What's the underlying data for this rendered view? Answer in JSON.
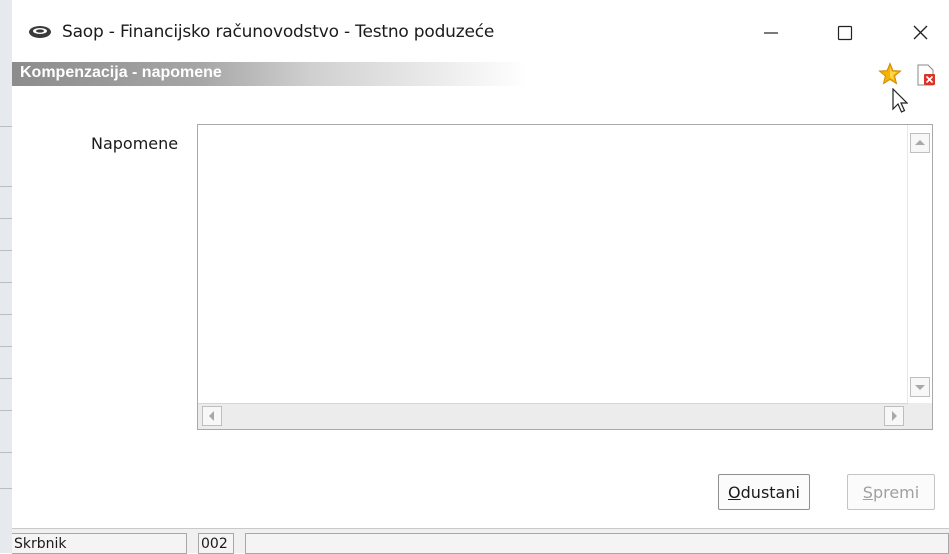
{
  "window": {
    "title": "Saop  - Financijsko računovodstvo  - Testno poduzeće",
    "controls": [
      "minimize",
      "maximize",
      "close"
    ]
  },
  "header": {
    "title": "Kompenzacija - napomene",
    "icons": [
      "star-icon",
      "close-document-icon"
    ]
  },
  "form": {
    "notes_label": "Napomene",
    "notes_value": ""
  },
  "buttons": {
    "cancel_label": "Odustani",
    "cancel_mnemonic": "O",
    "cancel_rest": "dustani",
    "save_label": "Spremi",
    "save_mnemonic": "S",
    "save_rest": "premi",
    "save_enabled": false
  },
  "statusbar": {
    "user": "Skrbnik",
    "code": "002",
    "rest": ""
  },
  "colors": {
    "header_gradient_start": "#8c8c8c",
    "star": "#f5b301",
    "close_doc_red": "#d9342b"
  }
}
